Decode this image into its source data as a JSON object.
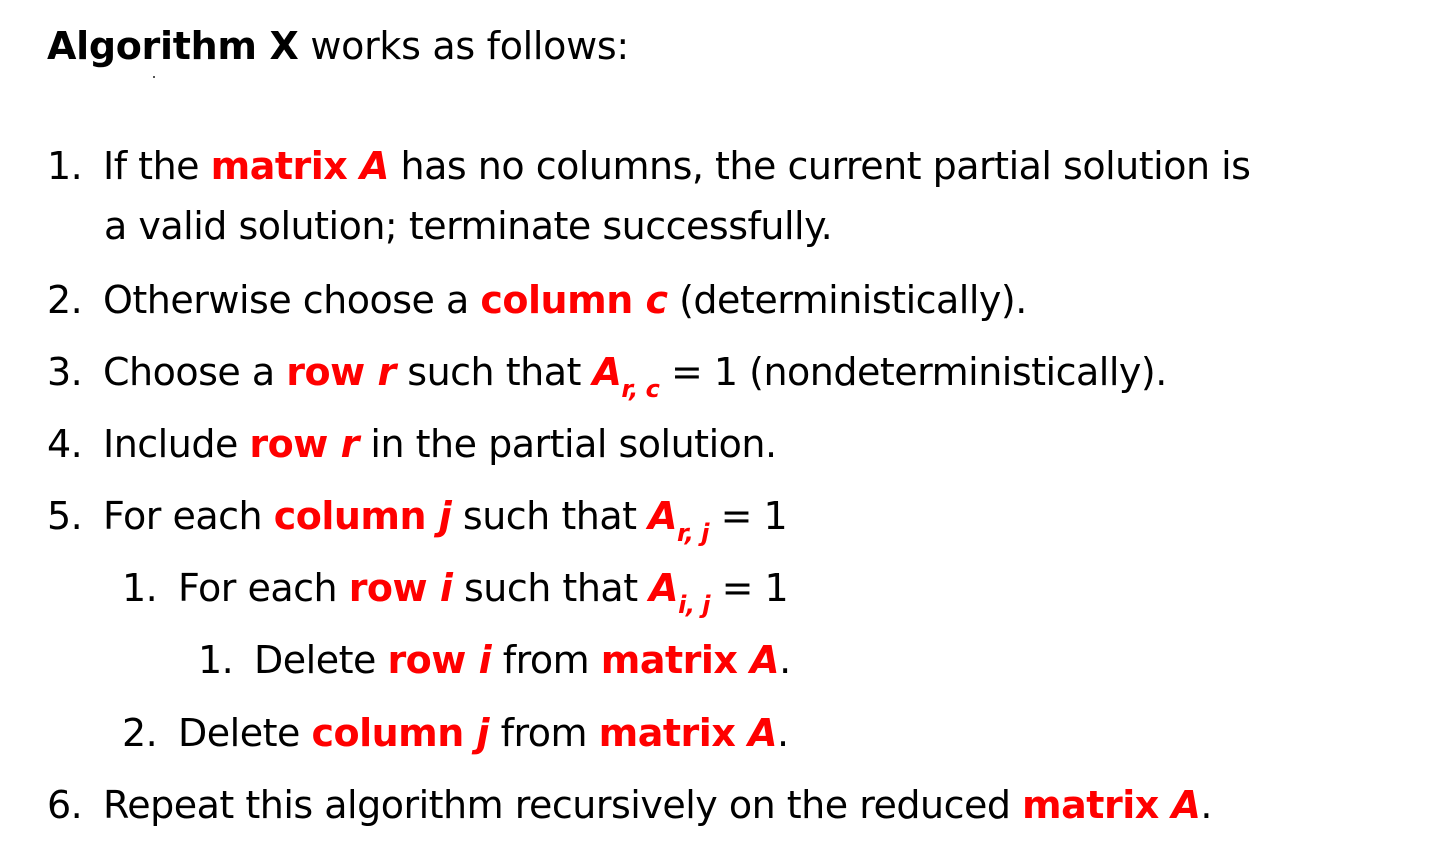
{
  "heading": {
    "bold": "Algorithm X",
    "rest": " works as follows:"
  },
  "steps": [
    {
      "num": "1.",
      "a1": "If the ",
      "h1": "matrix ",
      "h1i": "A",
      "a2": " has no columns, the current partial solution is",
      "cont": "a valid solution; terminate successfully."
    },
    {
      "num": "2.",
      "a1": "Otherwise choose a ",
      "h1": "column ",
      "h1i": "c",
      "a2": " (deterministically)."
    },
    {
      "num": "3.",
      "a1": "Choose a ",
      "h1": "row ",
      "h1i": "r",
      "a2": " such that ",
      "h2i": "A",
      "sub": "r, c",
      "a3": " = 1 (nondeterministically)."
    },
    {
      "num": "4.",
      "a1": "Include ",
      "h1": "row ",
      "h1i": "r",
      "a2": " in the partial solution."
    },
    {
      "num": "5.",
      "a1": "For each ",
      "h1": "column ",
      "h1i": "j",
      "a2": " such that ",
      "h2i": "A",
      "sub": "r, j",
      "a3": " = 1"
    },
    {
      "num": "1.",
      "a1": "For each ",
      "h1": "row ",
      "h1i": "i",
      "a2": " such that ",
      "h2i": "A",
      "sub": "i, j",
      "a3": " = 1"
    },
    {
      "num": "1.",
      "a1": "Delete ",
      "h1": "row ",
      "h1i": "i",
      "a2": " from ",
      "h2": "matrix ",
      "h2i": "A",
      "a3": "."
    },
    {
      "num": "2.",
      "a1": "Delete ",
      "h1": "column ",
      "h1i": "j",
      "a2": " from ",
      "h2": "matrix ",
      "h2i": "A",
      "a3": "."
    },
    {
      "num": "6.",
      "a1": "Repeat this algorithm recursively on the reduced ",
      "h2": "matrix ",
      "h2i": "A",
      "a3": "."
    }
  ]
}
